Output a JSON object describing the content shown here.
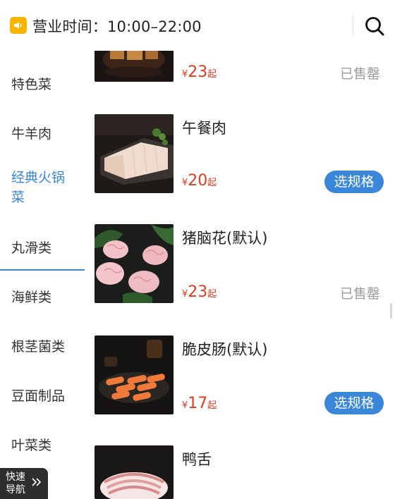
{
  "header": {
    "hours_label": "营业时间：10:00–22:00"
  },
  "sidebar": {
    "items": [
      {
        "label": "特色菜"
      },
      {
        "label": "牛羊肉"
      },
      {
        "label": "经典火锅菜"
      },
      {
        "label": "丸滑类"
      },
      {
        "label": "海鲜类"
      },
      {
        "label": "根茎菌类"
      },
      {
        "label": "豆面制品"
      },
      {
        "label": "叶菜类"
      }
    ],
    "active_index": 2
  },
  "dishes": [
    {
      "name": "",
      "currency": "¥",
      "price": "23",
      "suffix": "起",
      "status": "已售罄"
    },
    {
      "name": "午餐肉",
      "currency": "¥",
      "price": "20",
      "suffix": "起",
      "action": "选规格"
    },
    {
      "name": "猪脑花(默认)",
      "currency": "¥",
      "price": "23",
      "suffix": "起",
      "status": "已售罄"
    },
    {
      "name": "脆皮肠(默认)",
      "currency": "¥",
      "price": "17",
      "suffix": "起",
      "action": "选规格"
    },
    {
      "name": "鸭舌"
    }
  ],
  "quick_nav": {
    "label": "快速导航"
  },
  "colors": {
    "accent": "#3a86d8",
    "price": "#e23b22",
    "muted": "#9a9a9a",
    "badge": "#f7b500"
  }
}
